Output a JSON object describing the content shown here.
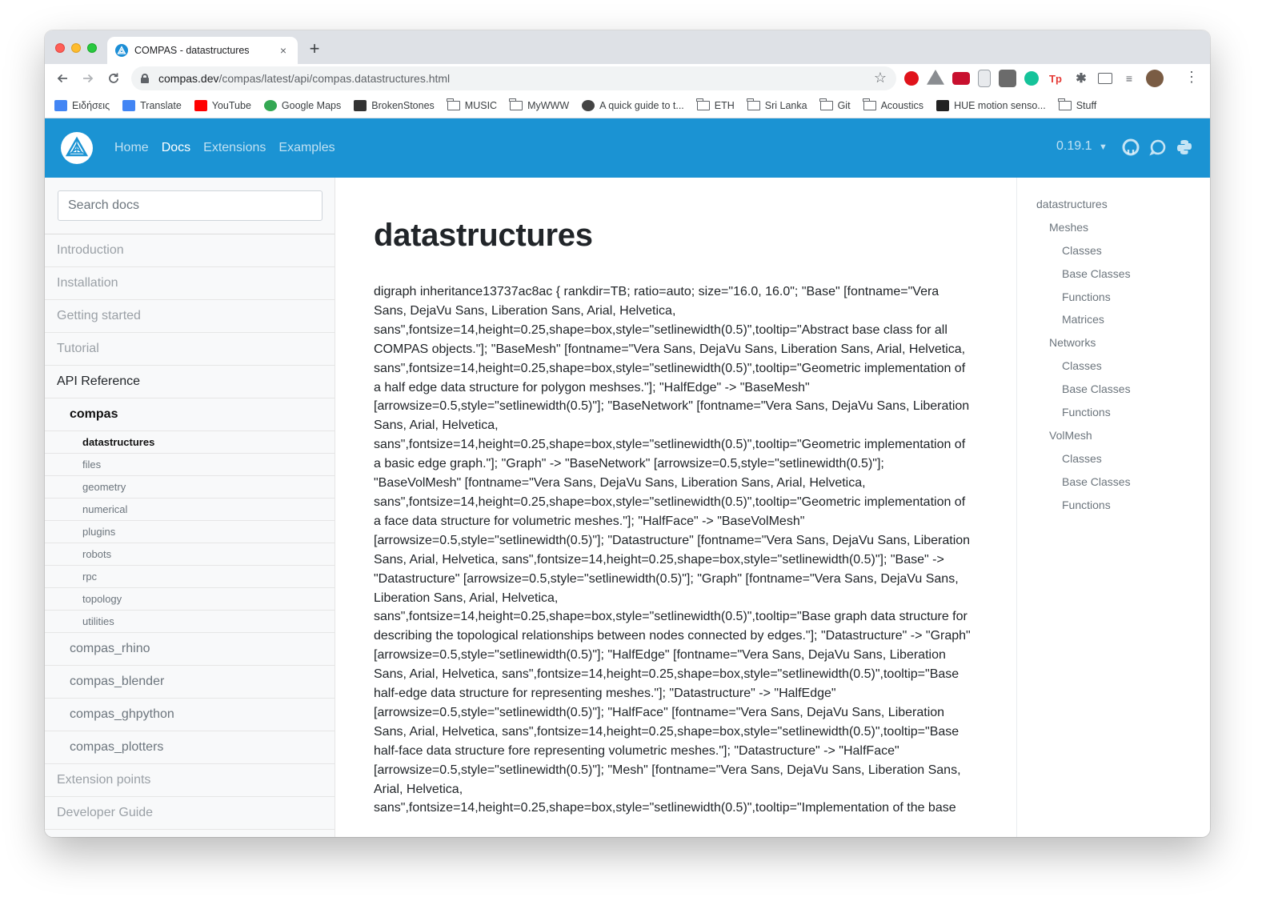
{
  "browser": {
    "tab_title": "COMPAS - datastructures",
    "tab_close": "×",
    "new_tab": "+",
    "url_host": "compas.dev",
    "url_path": "/compas/latest/api/compas.datastructures.html",
    "bookmarks": [
      {
        "label": "Ειδήσεις",
        "icon": "google-news-icon",
        "color": "#4285f4"
      },
      {
        "label": "Translate",
        "icon": "google-translate-icon",
        "color": "#4285f4"
      },
      {
        "label": "YouTube",
        "icon": "youtube-icon",
        "color": "#ff0000"
      },
      {
        "label": "Google Maps",
        "icon": "google-maps-icon",
        "color": "#34a853"
      },
      {
        "label": "BrokenStones",
        "icon": "brokenstones-icon",
        "color": "#333333"
      },
      {
        "label": "MUSIC",
        "icon": "folder-icon"
      },
      {
        "label": "MyWWW",
        "icon": "folder-icon"
      },
      {
        "label": "A quick guide to t...",
        "icon": "globe-icon",
        "color": "#444444"
      },
      {
        "label": "ETH",
        "icon": "folder-icon"
      },
      {
        "label": "Sri Lanka",
        "icon": "folder-icon"
      },
      {
        "label": "Git",
        "icon": "folder-icon"
      },
      {
        "label": "Acoustics",
        "icon": "folder-icon"
      },
      {
        "label": "HUE motion senso...",
        "icon": "hue-icon",
        "color": "#222222"
      },
      {
        "label": "Stuff",
        "icon": "folder-icon"
      }
    ]
  },
  "header": {
    "nav": [
      {
        "label": "Home",
        "active": false
      },
      {
        "label": "Docs",
        "active": true
      },
      {
        "label": "Extensions",
        "active": false
      },
      {
        "label": "Examples",
        "active": false
      }
    ],
    "version": "0.19.1",
    "accent_color": "#1b93d3"
  },
  "sidebar": {
    "search_placeholder": "Search docs",
    "items": [
      {
        "label": "Introduction",
        "level": 0
      },
      {
        "label": "Installation",
        "level": 0
      },
      {
        "label": "Getting started",
        "level": 0
      },
      {
        "label": "Tutorial",
        "level": 0
      },
      {
        "label": "API Reference",
        "level": 0,
        "strong": true
      },
      {
        "label": "compas",
        "level": 1,
        "bold": true
      },
      {
        "label": "datastructures",
        "level": 2,
        "active": true
      },
      {
        "label": "files",
        "level": 2
      },
      {
        "label": "geometry",
        "level": 2
      },
      {
        "label": "numerical",
        "level": 2
      },
      {
        "label": "plugins",
        "level": 2
      },
      {
        "label": "robots",
        "level": 2
      },
      {
        "label": "rpc",
        "level": 2
      },
      {
        "label": "topology",
        "level": 2
      },
      {
        "label": "utilities",
        "level": 2
      },
      {
        "label": "compas_rhino",
        "level": 1
      },
      {
        "label": "compas_blender",
        "level": 1
      },
      {
        "label": "compas_ghpython",
        "level": 1
      },
      {
        "label": "compas_plotters",
        "level": 1
      },
      {
        "label": "Extension points",
        "level": 0
      },
      {
        "label": "Developer Guide",
        "level": 0
      }
    ]
  },
  "main": {
    "title": "datastructures",
    "body": "digraph inheritance13737ac8ac { rankdir=TB; ratio=auto; size=\"16.0, 16.0\"; \"Base\" [fontname=\"Vera Sans, DejaVu Sans, Liberation Sans, Arial, Helvetica, sans\",fontsize=14,height=0.25,shape=box,style=\"setlinewidth(0.5)\",tooltip=\"Abstract base class for all COMPAS objects.\"]; \"BaseMesh\" [fontname=\"Vera Sans, DejaVu Sans, Liberation Sans, Arial, Helvetica, sans\",fontsize=14,height=0.25,shape=box,style=\"setlinewidth(0.5)\",tooltip=\"Geometric implementation of a half edge data structure for polygon meshses.\"]; \"HalfEdge\" -> \"BaseMesh\" [arrowsize=0.5,style=\"setlinewidth(0.5)\"]; \"BaseNetwork\" [fontname=\"Vera Sans, DejaVu Sans, Liberation Sans, Arial, Helvetica, sans\",fontsize=14,height=0.25,shape=box,style=\"setlinewidth(0.5)\",tooltip=\"Geometric implementation of a basic edge graph.\"]; \"Graph\" -> \"BaseNetwork\" [arrowsize=0.5,style=\"setlinewidth(0.5)\"]; \"BaseVolMesh\" [fontname=\"Vera Sans, DejaVu Sans, Liberation Sans, Arial, Helvetica, sans\",fontsize=14,height=0.25,shape=box,style=\"setlinewidth(0.5)\",tooltip=\"Geometric implementation of a face data structure for volumetric meshes.\"]; \"HalfFace\" -> \"BaseVolMesh\" [arrowsize=0.5,style=\"setlinewidth(0.5)\"]; \"Datastructure\" [fontname=\"Vera Sans, DejaVu Sans, Liberation Sans, Arial, Helvetica, sans\",fontsize=14,height=0.25,shape=box,style=\"setlinewidth(0.5)\"]; \"Base\" -> \"Datastructure\" [arrowsize=0.5,style=\"setlinewidth(0.5)\"]; \"Graph\" [fontname=\"Vera Sans, DejaVu Sans, Liberation Sans, Arial, Helvetica, sans\",fontsize=14,height=0.25,shape=box,style=\"setlinewidth(0.5)\",tooltip=\"Base graph data structure for describing the topological relationships between nodes connected by edges.\"]; \"Datastructure\" -> \"Graph\" [arrowsize=0.5,style=\"setlinewidth(0.5)\"]; \"HalfEdge\" [fontname=\"Vera Sans, DejaVu Sans, Liberation Sans, Arial, Helvetica, sans\",fontsize=14,height=0.25,shape=box,style=\"setlinewidth(0.5)\",tooltip=\"Base half-edge data structure for representing meshes.\"]; \"Datastructure\" -> \"HalfEdge\" [arrowsize=0.5,style=\"setlinewidth(0.5)\"]; \"HalfFace\" [fontname=\"Vera Sans, DejaVu Sans, Liberation Sans, Arial, Helvetica, sans\",fontsize=14,height=0.25,shape=box,style=\"setlinewidth(0.5)\",tooltip=\"Base half-face data structure fore representing volumetric meshes.\"]; \"Datastructure\" -> \"HalfFace\" [arrowsize=0.5,style=\"setlinewidth(0.5)\"]; \"Mesh\" [fontname=\"Vera Sans, DejaVu Sans, Liberation Sans, Arial, Helvetica, sans\",fontsize=14,height=0.25,shape=box,style=\"setlinewidth(0.5)\",tooltip=\"Implementation of the base"
  },
  "toc": [
    {
      "label": "datastructures",
      "level": 0
    },
    {
      "label": "Meshes",
      "level": 1
    },
    {
      "label": "Classes",
      "level": 2
    },
    {
      "label": "Base Classes",
      "level": 2
    },
    {
      "label": "Functions",
      "level": 2
    },
    {
      "label": "Matrices",
      "level": 2
    },
    {
      "label": "Networks",
      "level": 1
    },
    {
      "label": "Classes",
      "level": 2
    },
    {
      "label": "Base Classes",
      "level": 2
    },
    {
      "label": "Functions",
      "level": 2
    },
    {
      "label": "VolMesh",
      "level": 1
    },
    {
      "label": "Classes",
      "level": 2
    },
    {
      "label": "Base Classes",
      "level": 2
    },
    {
      "label": "Functions",
      "level": 2
    }
  ]
}
